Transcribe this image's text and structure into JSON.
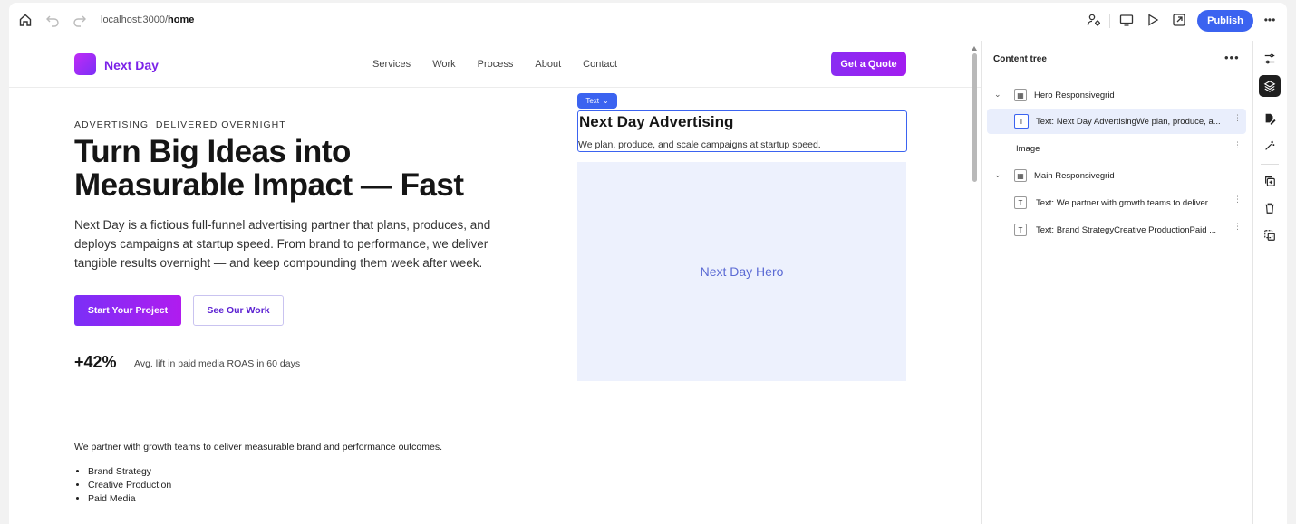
{
  "toolbar": {
    "url_prefix": "localhost:3000/",
    "url_path": "home",
    "publish_label": "Publish",
    "more_label": "•••"
  },
  "site": {
    "logo_text": "Next Day",
    "nav": [
      "Services",
      "Work",
      "Process",
      "About",
      "Contact"
    ],
    "quote_label": "Get a Quote",
    "eyebrow": "ADVERTISING, DELIVERED OVERNIGHT",
    "hero_title_line1": "Turn Big Ideas into",
    "hero_title_line2": "Measurable Impact — Fast",
    "hero_desc": "Next Day is a fictious full-funnel advertising partner that plans, produces, and deploys campaigns at startup speed. From brand to performance, we deliver tangible results overnight — and keep compounding them week after week.",
    "primary_cta": "Start Your Project",
    "secondary_cta": "See Our Work",
    "stat_value": "+42%",
    "stat_label": "Avg. lift in paid media ROAS in 60 days",
    "selected_tag": "Text",
    "selected_title": "Next Day Advertising",
    "selected_desc": "We plan, produce, and scale campaigns at startup speed.",
    "hero_image_label": "Next Day Hero",
    "main_text": "We partner with growth teams to deliver measurable brand and performance outcomes.",
    "services": [
      "Brand Strategy",
      "Creative Production",
      "Paid Media"
    ]
  },
  "panel": {
    "title": "Content tree",
    "more_label": "•••",
    "nodes": [
      {
        "label": "Hero Responsivegrid",
        "icon": "T"
      },
      {
        "label": "Text: Next Day AdvertisingWe plan, produce, a...",
        "icon": "T"
      },
      {
        "label": "Image"
      },
      {
        "label": "Main Responsivegrid"
      },
      {
        "label": "Text: We partner with growth teams to deliver ...",
        "icon": "T"
      },
      {
        "label": "Text: Brand StrategyCreative ProductionPaid ...",
        "icon": "T"
      }
    ]
  },
  "colors": {
    "accent": "#3b63f0",
    "brand": "#7b22e8",
    "hero_image_bg": "#edf1fd"
  }
}
